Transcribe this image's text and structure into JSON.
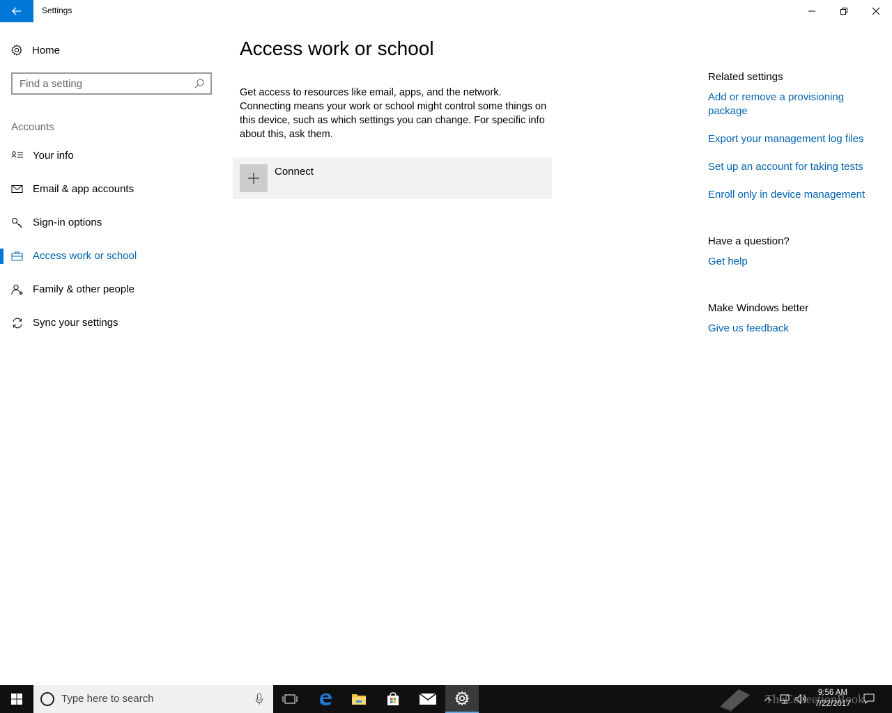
{
  "window": {
    "title": "Settings",
    "back_icon": "arrow-left-icon",
    "controls": [
      "minimize-icon",
      "restore-icon",
      "close-icon"
    ]
  },
  "nav": {
    "home_label": "Home",
    "search_placeholder": "Find a setting",
    "section_label": "Accounts",
    "items": [
      {
        "label": "Your info",
        "icon": "contact-card-icon",
        "active": false
      },
      {
        "label": "Email & app accounts",
        "icon": "mail-icon",
        "active": false
      },
      {
        "label": "Sign-in options",
        "icon": "key-icon",
        "active": false
      },
      {
        "label": "Access work or school",
        "icon": "briefcase-icon",
        "active": true
      },
      {
        "label": "Family & other people",
        "icon": "person-add-icon",
        "active": false
      },
      {
        "label": "Sync your settings",
        "icon": "sync-icon",
        "active": false
      }
    ]
  },
  "main": {
    "title": "Access work or school",
    "description": "Get access to resources like email, apps, and the network. Connecting means your work or school might control some things on this device, such as which settings you can change. For specific info about this, ask them.",
    "connect_label": "Connect"
  },
  "related": {
    "heading": "Related settings",
    "links": [
      "Add or remove a provisioning package",
      "Export your management log files",
      "Set up an account for taking tests",
      "Enroll only in device management"
    ],
    "question_heading": "Have a question?",
    "help_link": "Get help",
    "better_heading": "Make Windows better",
    "feedback_link": "Give us feedback"
  },
  "taskbar": {
    "search_placeholder": "Type here to search",
    "pinned": [
      "task-view-icon",
      "edge-icon",
      "file-explorer-icon",
      "store-icon",
      "mail-icon",
      "settings-icon"
    ],
    "time": "9:56 AM",
    "date": "7/22/2017",
    "watermark": "TheCollectionBook"
  },
  "colors": {
    "accent": "#0078d7",
    "link": "#0063b1"
  }
}
